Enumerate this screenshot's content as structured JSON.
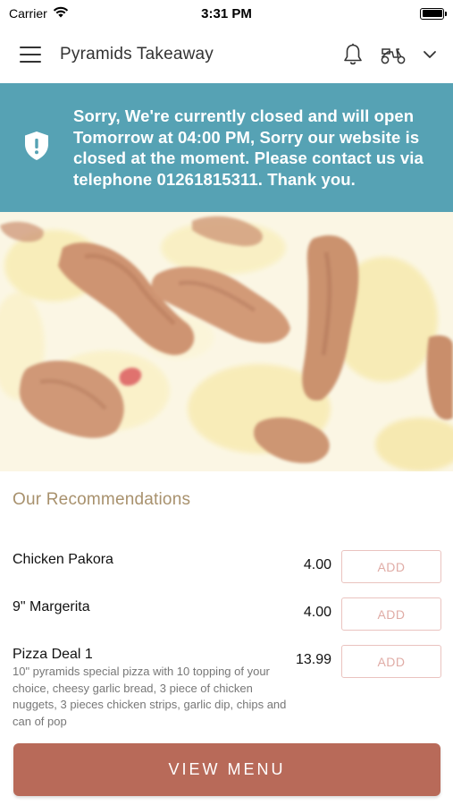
{
  "status_bar": {
    "carrier": "Carrier",
    "time": "3:31 PM"
  },
  "header": {
    "title": "Pyramids Takeaway",
    "icons": [
      "menu-icon",
      "bell-icon",
      "scooter-icon",
      "chevron-down-icon"
    ]
  },
  "banner": {
    "message": "Sorry, We're currently closed and will open Tomorrow at 04:00 PM, Sorry our website is closed at the moment. Please contact us via telephone 01261815311. Thank you.",
    "background": "#56a2b4",
    "icon": "shield-alert-icon"
  },
  "recommendations": {
    "title": "Our Recommendations",
    "items": [
      {
        "name": "Chicken Pakora",
        "price": "4.00",
        "add_label": "ADD",
        "description": ""
      },
      {
        "name": "9\" Margerita",
        "price": "4.00",
        "add_label": "ADD",
        "description": ""
      },
      {
        "name": "Pizza Deal 1",
        "price": "13.99",
        "add_label": "ADD",
        "description": "10\" pyramids special pizza with 10 topping of your choice, cheesy garlic bread, 3 piece of chicken nuggets, 3 pieces chicken strips, garlic dip, chips and can of pop"
      }
    ]
  },
  "view_menu": {
    "label": "VIEW MENU",
    "background": "#b86a59"
  }
}
